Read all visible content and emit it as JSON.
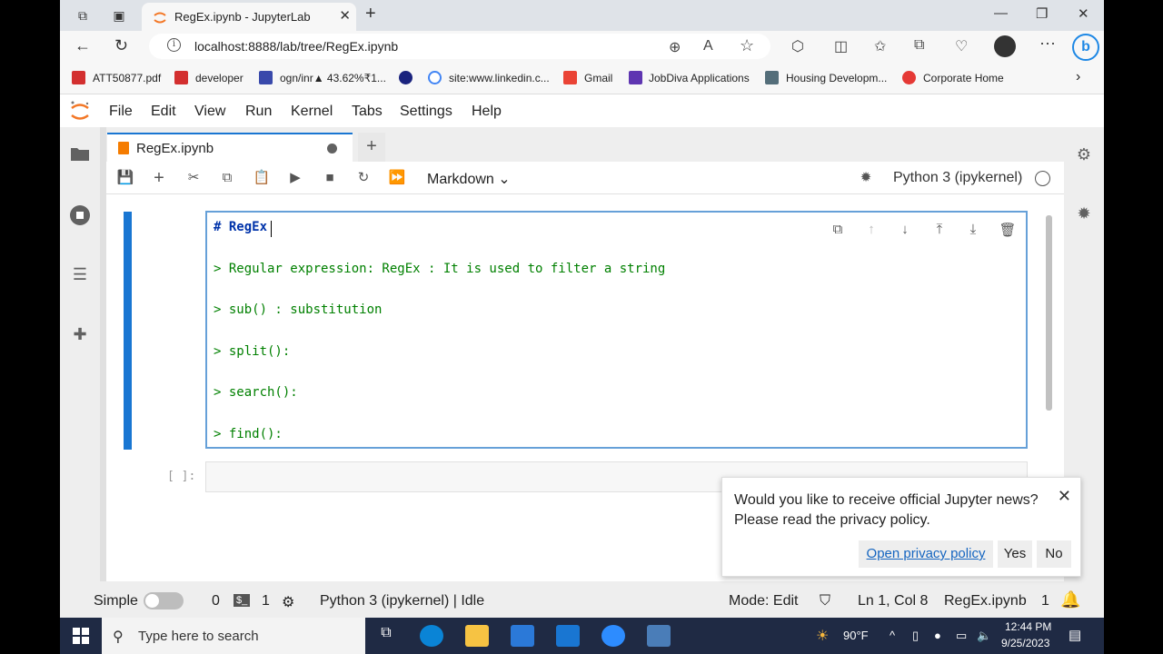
{
  "browser": {
    "tab_title": "RegEx.ipynb - JupyterLab",
    "url": "localhost:8888/lab/tree/RegEx.ipynb",
    "bookmarks": [
      "ATT50877.pdf",
      "developer",
      "ogn/inr▲ 43.62%₹1...",
      "site:www.linkedin.c...",
      "Gmail",
      "JobDiva Applications",
      "Housing Developm...",
      "Corporate Home"
    ]
  },
  "menu": [
    "File",
    "Edit",
    "View",
    "Run",
    "Kernel",
    "Tabs",
    "Settings",
    "Help"
  ],
  "doc_tab": {
    "name": "RegEx.ipynb"
  },
  "toolbar": {
    "cell_type": "Markdown",
    "kernel": "Python 3 (ipykernel)"
  },
  "cell": {
    "lines": [
      "# RegEx",
      "> Regular expression: RegEx : It is used to filter a string",
      "> sub() : substitution",
      "> split():",
      "> search():",
      "> find():"
    ]
  },
  "code_cell": {
    "prompt": "[ ]:"
  },
  "notification": {
    "message": "Would you like to receive official Jupyter news? Please read the privacy policy.",
    "link": "Open privacy policy",
    "yes": "Yes",
    "no": "No"
  },
  "status": {
    "mode_label": "Simple",
    "terminals": "0",
    "kernels": "1",
    "kernel_status": "Python 3 (ipykernel) | Idle",
    "mode": "Mode: Edit",
    "position": "Ln 1, Col 8",
    "filename": "RegEx.ipynb",
    "notifications": "1"
  },
  "taskbar": {
    "search_placeholder": "Type here to search",
    "weather": "90°F",
    "time": "12:44 PM",
    "date": "9/25/2023"
  }
}
